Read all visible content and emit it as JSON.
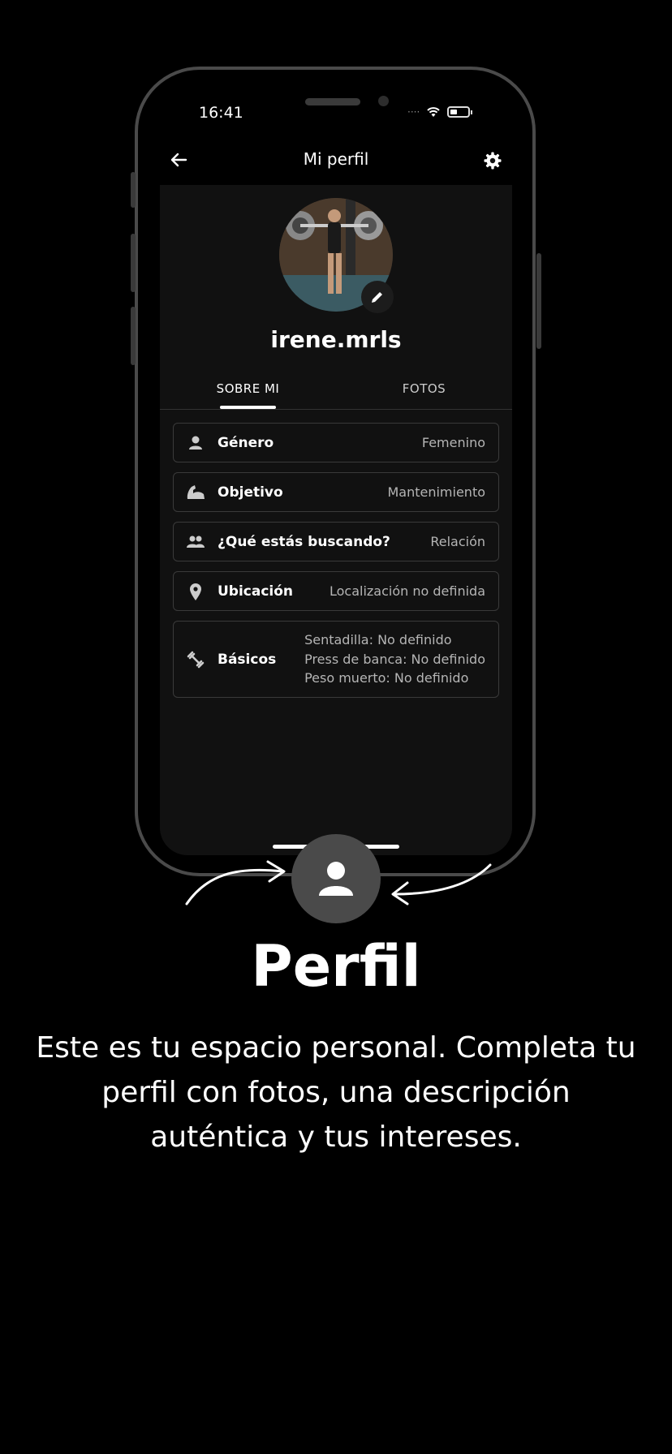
{
  "status_bar": {
    "time": "16:41"
  },
  "header": {
    "title": "Mi perfil"
  },
  "profile": {
    "username": "irene.mrls"
  },
  "tabs": [
    {
      "label": "SOBRE MI",
      "active": true
    },
    {
      "label": "FOTOS",
      "active": false
    }
  ],
  "details": [
    {
      "icon": "person-icon",
      "label": "Género",
      "value": "Femenino"
    },
    {
      "icon": "flexed-arm-icon",
      "label": "Objetivo",
      "value": "Mantenimiento"
    },
    {
      "icon": "people-icon",
      "label": "¿Qué estás buscando?",
      "value": "Relación"
    },
    {
      "icon": "location-pin-icon",
      "label": "Ubicación",
      "value": "Localización no definida"
    }
  ],
  "basics": {
    "icon": "dumbbell-icon",
    "label": "Básicos",
    "values": [
      "Sentadilla: No definido",
      "Press de banca: No definido",
      "Peso muerto: No definido"
    ]
  },
  "feature": {
    "title": "Perfil",
    "description": "Este es tu espacio personal. Completa tu perfil con fotos, una descripción auténtica y tus intereses."
  },
  "colors": {
    "background": "#000000",
    "screen": "#111111",
    "accent": "#4a4a4a"
  }
}
